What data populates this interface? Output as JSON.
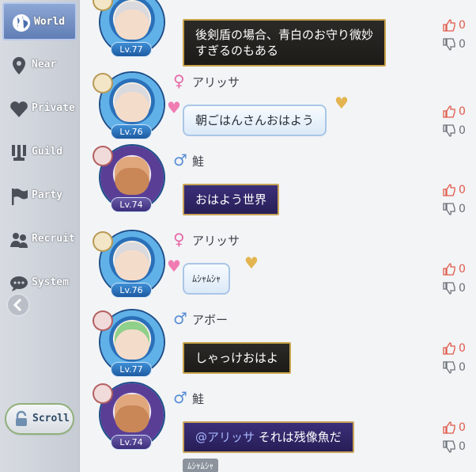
{
  "sidebar": {
    "channels": [
      {
        "label": "World",
        "icon": "globe-icon"
      },
      {
        "label": "Near",
        "icon": "location-pin-icon"
      },
      {
        "label": "Private",
        "icon": "heart-icon"
      },
      {
        "label": "Guild",
        "icon": "guild-emblem-icon"
      },
      {
        "label": "Party",
        "icon": "flag-icon"
      },
      {
        "label": "Recruit",
        "icon": "people-icon"
      },
      {
        "label": "System",
        "icon": "speech-bubble-icon"
      }
    ],
    "scroll_label": "Scroll"
  },
  "messages": [
    {
      "gender": "",
      "name": "",
      "level": "Lv.77",
      "text": "後剣盾の場合、青白のお守り微妙\nすぎるのもある",
      "style": "dark",
      "likes": "0",
      "dislikes": "0"
    },
    {
      "gender": "♀",
      "name": "アリッサ",
      "level": "Lv.76",
      "text": "朝ごはんさんおはよう",
      "style": "light",
      "likes": "0",
      "dislikes": "0"
    },
    {
      "gender": "♂",
      "name": "鮭",
      "level": "Lv.74",
      "text": "おはよう世界",
      "style": "violet",
      "likes": "0",
      "dislikes": "0"
    },
    {
      "gender": "♀",
      "name": "アリッサ",
      "level": "Lv.76",
      "text": "ﾑｼｬﾑｼｬ",
      "style": "light",
      "likes": "0",
      "dislikes": "0"
    },
    {
      "gender": "♂",
      "name": "アボー",
      "level": "Lv.77",
      "text": "しゃっけおはよ",
      "style": "dark",
      "likes": "0",
      "dislikes": "0"
    },
    {
      "gender": "♂",
      "name": "鮭",
      "level": "Lv.74",
      "mention": "@アリッサ",
      "text": "それは残像魚だ",
      "style": "violet",
      "likes": "0",
      "dislikes": "0"
    }
  ],
  "footer_preview": "ﾑｼｬﾑｼｬ",
  "colors": {
    "accent_channel": "#6d88c2",
    "like": "#e05a4b",
    "bubble_gold_border": "#c7a24a"
  }
}
